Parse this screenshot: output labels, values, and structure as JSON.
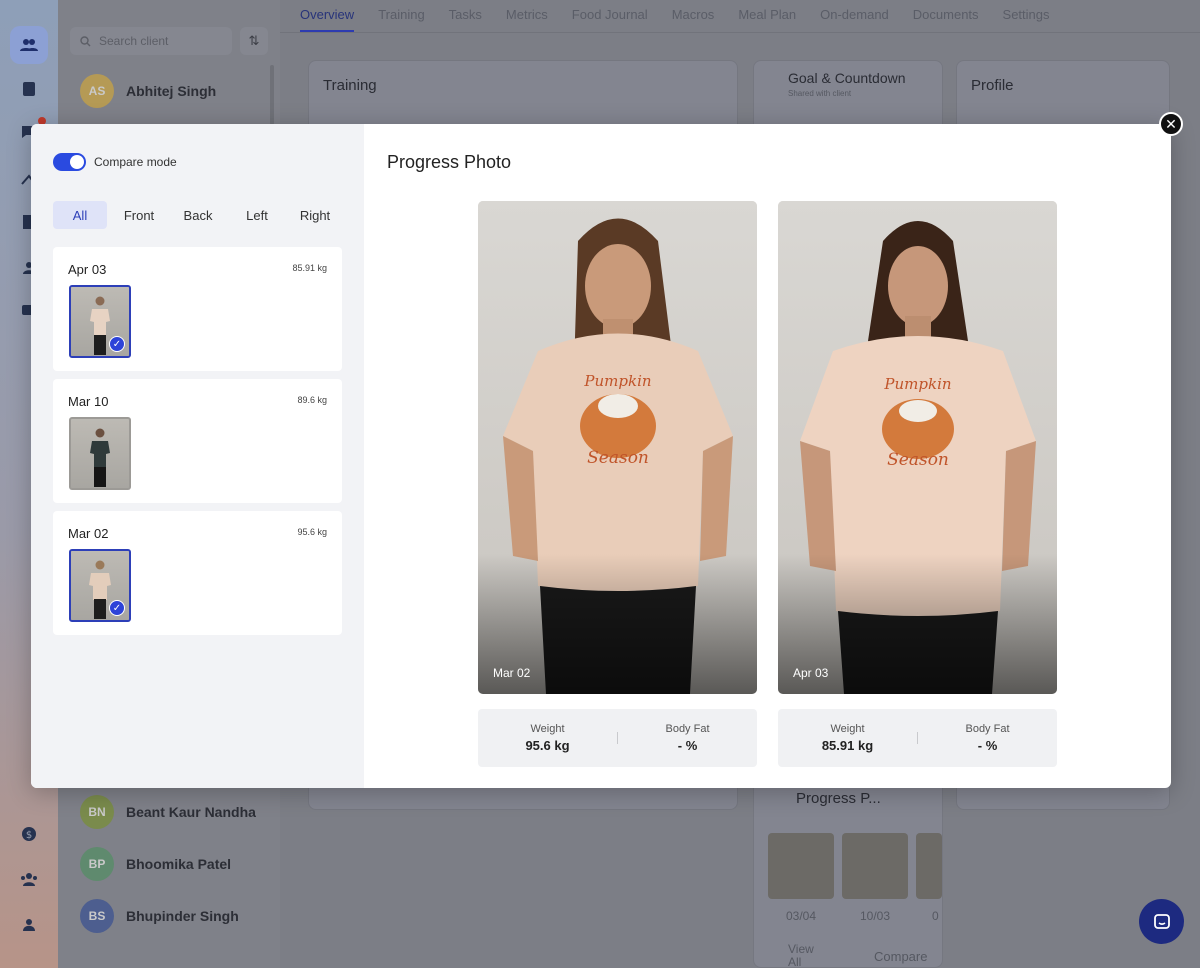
{
  "background": {
    "search_placeholder": "Search client",
    "tabs": [
      "Overview",
      "Training",
      "Tasks",
      "Metrics",
      "Food Journal",
      "Macros",
      "Meal Plan",
      "On-demand",
      "Documents",
      "Settings"
    ],
    "clients": [
      {
        "initials": "AS",
        "name": "Abhitej Singh",
        "color": "#b59a55"
      },
      {
        "initials": "BN",
        "name": "Beant Kaur Nandha",
        "color": "#7a8b4c"
      },
      {
        "initials": "BP",
        "name": "Bhoomika Patel",
        "color": "#5f8a6e"
      },
      {
        "initials": "BS",
        "name": "Bhupinder Singh",
        "color": "#4d5e8f"
      }
    ],
    "cards": {
      "training": "Training",
      "goal": "Goal & Countdown",
      "goal_sub": "Shared with client",
      "profile": "Profile",
      "progress": "Progress P...",
      "progress_dates": [
        "03/04",
        "10/03",
        "0"
      ],
      "view_all": "View All",
      "compare": "Compare"
    }
  },
  "modal": {
    "compare_mode_label": "Compare mode",
    "compare_mode_on": true,
    "filters": [
      "All",
      "Front",
      "Back",
      "Left",
      "Right"
    ],
    "entries": [
      {
        "date": "Apr 03",
        "weight": "85.91 kg",
        "selected": true
      },
      {
        "date": "Mar 10",
        "weight": "89.6 kg",
        "selected": false
      },
      {
        "date": "Mar 02",
        "weight": "95.6 kg",
        "selected": true
      }
    ],
    "title": "Progress Photo",
    "photos": [
      {
        "caption": "Mar 02",
        "weight_label": "Weight",
        "weight": "95.6 kg",
        "bodyfat_label": "Body Fat",
        "bodyfat": "- %"
      },
      {
        "caption": "Apr 03",
        "weight_label": "Weight",
        "weight": "85.91 kg",
        "bodyfat_label": "Body Fat",
        "bodyfat": "- %"
      }
    ]
  },
  "icons": {
    "close": "close-icon",
    "check": "check-icon",
    "search": "search-icon",
    "sort": "sort-icon"
  },
  "colors": {
    "accent": "#2d3fb8",
    "toggle": "#2a4ae0",
    "overlay": "#7d7f86"
  }
}
